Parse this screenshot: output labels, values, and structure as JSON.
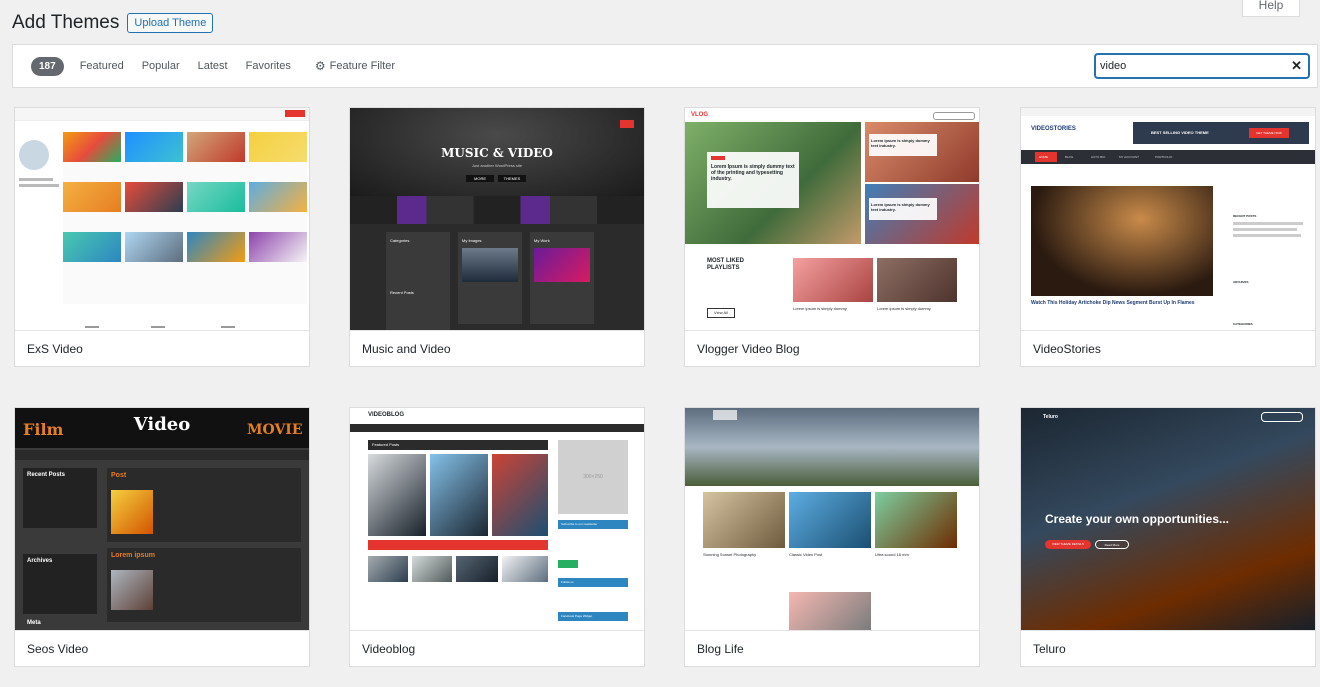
{
  "help_label": "Help",
  "header": {
    "title": "Add Themes",
    "upload_label": "Upload Theme"
  },
  "filter_bar": {
    "count": "187",
    "links": [
      "Featured",
      "Popular",
      "Latest",
      "Favorites"
    ],
    "feature_filter": "Feature Filter",
    "search_value": "video"
  },
  "themes": [
    {
      "name": "ExS Video",
      "preview": {
        "columns": [
          "",
          "",
          ""
        ]
      }
    },
    {
      "name": "Music and Video",
      "preview": {
        "heading": "MUSIC & VIDEO",
        "tagline": "Just another WordPress site",
        "btn1": "MORE",
        "btn2": "THEMES",
        "widget_titles": [
          "Categories",
          "My Images",
          "My Work"
        ],
        "recent": "Recent Posts"
      }
    },
    {
      "name": "Vlogger Video Blog",
      "preview": {
        "logo": "VLOG",
        "hero": "Lorem Ipsum is simply dummy text of the printing and typesetting industry.",
        "side1": "Lorem ipsum is simply dummy text industry.",
        "side2": "Lorem ipsum is simply dummy text industry.",
        "most_liked": "MOST LIKED PLAYLISTS",
        "view_all": "View All",
        "card1": "Lorem ipsum is simply dummy",
        "card2": "Lorem ipsum is simply dummy"
      }
    },
    {
      "name": "VideoStories",
      "preview": {
        "logo": "VIDEOSTORIES",
        "banner": "BEST SELLING VIDEO THEME",
        "banner_btn": "GET THEME NOW",
        "nav": [
          "HOME",
          "BLOG",
          "AUTO BIO",
          "MY ACCOUNT",
          "PORTFOLIO"
        ],
        "headline": "Watch This Holiday Artichoke Dip News Segment Burst Up In Flames",
        "recent_posts": "RECENT POSTS",
        "archives": "ARCHIVES",
        "categories": "CATEGORIES"
      }
    },
    {
      "name": "Seos Video",
      "preview": {
        "title": "Video",
        "left_title": "Film",
        "right_title": "MOVIE",
        "recent": "Recent Posts",
        "archives": "Archives",
        "meta": "Meta",
        "post": "Post",
        "lorem": "Lorem ipsum"
      }
    },
    {
      "name": "Videoblog",
      "preview": {
        "logo": "VIDEOBLOG",
        "featured": "Featured Posts",
        "ad": "300×250",
        "newsletter": "Subscribe to our newsletter",
        "follow": "Follow us",
        "page_widget": "Facebook Page Widget"
      }
    },
    {
      "name": "Blog Life",
      "preview": {
        "post1": "Stunning Sunset Photography",
        "post2": "Classic Video Post",
        "post3": "Ultra sound 18 mm"
      }
    },
    {
      "name": "Teluro",
      "preview": {
        "logo": "Teluro",
        "headline": "Create your own opportunities...",
        "btn1": "VIEW THEME DETAILS",
        "btn2": "Read More"
      }
    }
  ]
}
